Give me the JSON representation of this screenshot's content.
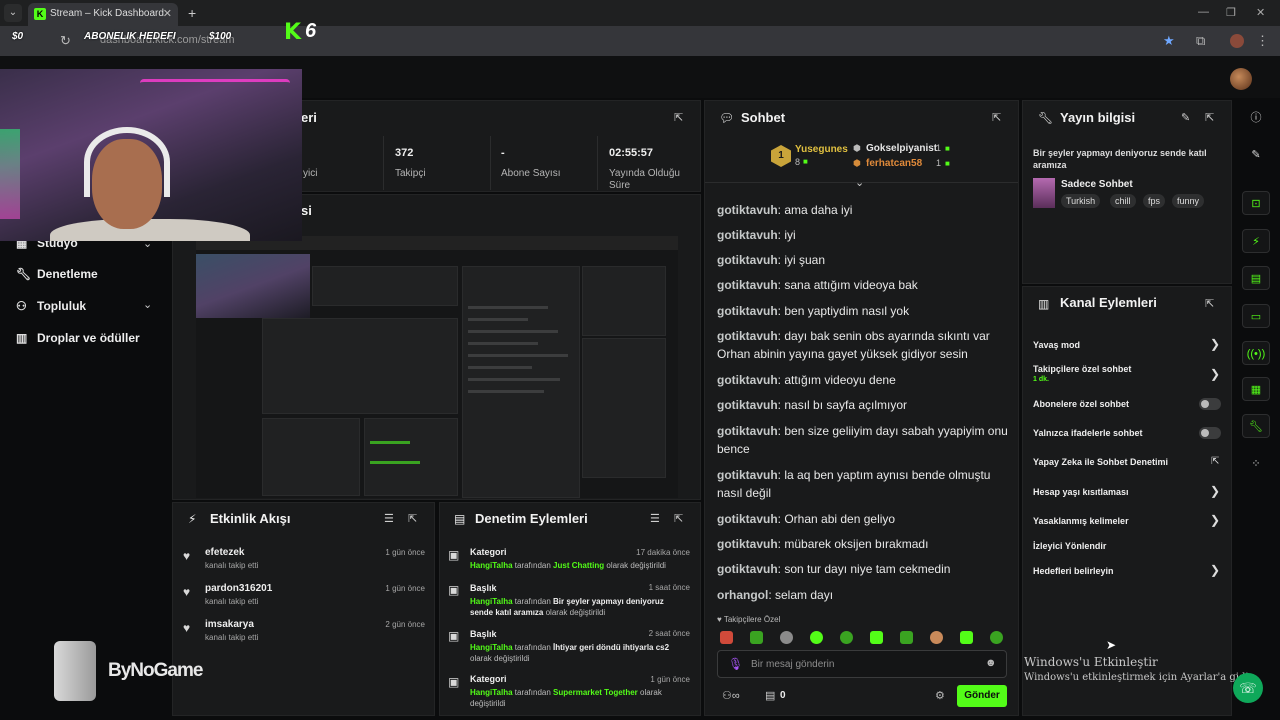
{
  "browser": {
    "tab_title": "Stream – Kick Dashboard",
    "url": "dashboard.kick.com/stream"
  },
  "overlay": {
    "left_amount": "$0",
    "goal_label": "ABONELIK HEDEFI",
    "right_amount": "$100",
    "kick_count": "6"
  },
  "sidebar": {
    "items": [
      {
        "label": "Stüdyo",
        "icon": "studio-icon"
      },
      {
        "label": "Denetleme",
        "icon": "wrench-icon"
      },
      {
        "label": "Topluluk",
        "icon": "community-icon"
      },
      {
        "label": "Droplar ve ödüller",
        "icon": "drops-icon"
      }
    ]
  },
  "stats_panel": {
    "title_fragment": "eri",
    "stats": [
      {
        "value": "",
        "label": "yici"
      },
      {
        "value": "372",
        "label": "Takipçi"
      },
      {
        "value": "-",
        "label": "Abone Sayısı"
      },
      {
        "value": "02:55:57",
        "label": "Yayında Olduğu Süre"
      }
    ]
  },
  "preview_panel": {
    "title_fragment": "si"
  },
  "activity_feed": {
    "title": "Etkinlik Akışı",
    "items": [
      {
        "name": "efetezek",
        "sub": "kanalı takip etti",
        "time": "1 gün önce"
      },
      {
        "name": "pardon316201",
        "sub": "kanalı takip etti",
        "time": "1 gün önce"
      },
      {
        "name": "imsakarya",
        "sub": "kanalı takip etti",
        "time": "2 gün önce"
      }
    ]
  },
  "mod_actions": {
    "title": "Denetim Eylemleri",
    "items": [
      {
        "type": "Kategori",
        "time": "17 dakika önce",
        "user": "HangiTalha",
        "mid": "tarafından",
        "value": "Just Chatting",
        "tail": "olarak değiştirildi"
      },
      {
        "type": "Başlık",
        "time": "1 saat önce",
        "user": "HangiTalha",
        "mid": "tarafından",
        "value": "Bir şeyler yapmayı deniyoruz sende katıl aramıza",
        "tail": "olarak değiştirildi"
      },
      {
        "type": "Başlık",
        "time": "2 saat önce",
        "user": "HangiTalha",
        "mid": "tarafından",
        "value": "İhtiyar geri döndü ihtiyarla cs2",
        "tail": "olarak değiştirildi"
      },
      {
        "type": "Kategori",
        "time": "1 gün önce",
        "user": "HangiTalha",
        "mid": "tarafından",
        "value": "Supermarket Together",
        "tail": "olarak değiştirildi"
      }
    ]
  },
  "chat": {
    "title": "Sohbet",
    "leaderboard": [
      {
        "name": "Yusegunes",
        "count": "8",
        "rank": "1"
      },
      {
        "name": "Gokselpiyanist",
        "count": "1"
      },
      {
        "name": "ferhatcan58",
        "count": "1"
      }
    ],
    "messages": [
      {
        "user": "gotiktavuh",
        "text": "ama daha iyi"
      },
      {
        "user": "gotiktavuh",
        "text": "iyi"
      },
      {
        "user": "gotiktavuh",
        "text": "iyi şuan"
      },
      {
        "user": "gotiktavuh",
        "text": "sana attığım videoya bak"
      },
      {
        "user": "gotiktavuh",
        "text": "ben yaptiydim nasıl yok"
      },
      {
        "user": "gotiktavuh",
        "text": "dayı bak senin obs ayarında sıkıntı var Orhan abinin yayına gayet yüksek gidiyor sesin"
      },
      {
        "user": "gotiktavuh",
        "text": "attığım videoyu dene"
      },
      {
        "user": "gotiktavuh",
        "text": "nasıl bı sayfa açılmıyor"
      },
      {
        "user": "gotiktavuh",
        "text": "ben size geliiyim dayı sabah yyapiyim onu bence"
      },
      {
        "user": "gotiktavuh",
        "text": "la aq ben yaptım aynısı bende olmuştu nasıl değil"
      },
      {
        "user": "gotiktavuh",
        "text": "Orhan abi den geliyo"
      },
      {
        "user": "gotiktavuh",
        "text": "mübarek oksijen bırakmadı"
      },
      {
        "user": "gotiktavuh",
        "text": "son tur dayı niye tam cekmedin"
      },
      {
        "user": "orhangol",
        "text": "selam dayı"
      }
    ],
    "followers_only": "Takipçilere Özel",
    "input_placeholder": "Bir mesaj gönderin",
    "counter": "0",
    "send_label": "Gönder"
  },
  "stream_info": {
    "title": "Yayın bilgisi",
    "stream_title": "Bir şeyler yapmayı deniyoruz sende katıl aramıza",
    "category": "Sadece Sohbet",
    "tags": [
      "Turkish",
      "chill",
      "fps",
      "funny"
    ]
  },
  "channel_actions": {
    "title": "Kanal Eylemleri",
    "items": [
      {
        "label": "Yavaş mod",
        "control": "chevron"
      },
      {
        "label": "Takipçilere özel sohbet",
        "sub": "1 dk.",
        "control": "chevron"
      },
      {
        "label": "Abonelere özel sohbet",
        "control": "toggle",
        "on": false
      },
      {
        "label": "Yalnızca ifadelerle sohbet",
        "control": "toggle",
        "on": false
      },
      {
        "label": "Yapay Zeka ile Sohbet Denetimi",
        "control": "external"
      },
      {
        "label": "Hesap yaşı kısıtlaması",
        "control": "chevron"
      },
      {
        "label": "Yasaklanmış kelimeler",
        "control": "chevron"
      },
      {
        "label": "İzleyici Yönlendir",
        "control": "none"
      },
      {
        "label": "Hedefleri belirleyin",
        "control": "chevron"
      }
    ]
  },
  "windows_activation": {
    "title": "Windows'u Etkinleştir",
    "sub": "Windows'u etkinleştirmek için Ayarlar'a gidin."
  },
  "sponsor": "ByNoGame",
  "colors": {
    "accent": "#53fc18",
    "panel": "#191a1b",
    "background": "#0b0c0d"
  }
}
